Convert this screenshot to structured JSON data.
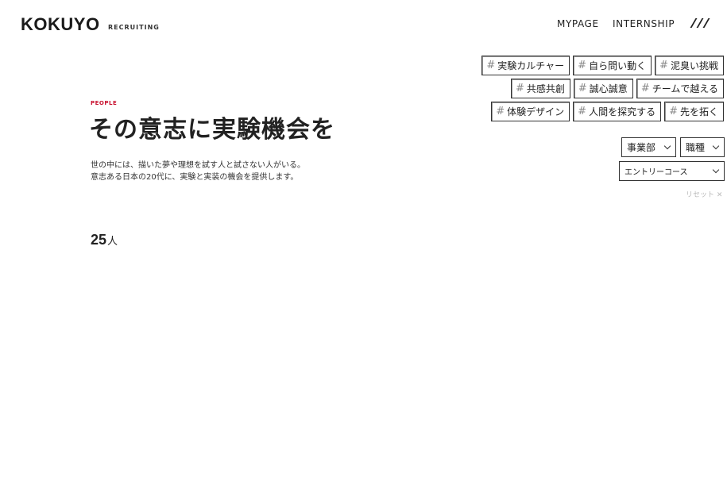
{
  "header": {
    "logo": "KOKUYO",
    "logo_sub": "RECRUITING",
    "nav": {
      "mypage": "MYPAGE",
      "internship": "INTERNSHIP"
    }
  },
  "hero": {
    "label": "PEOPLE",
    "title": "その意志に実験機会を",
    "lead_line1": "世の中には、描いた夢や理想を試す人と試さない人がいる。",
    "lead_line2": "意志ある日本の20代に、実験と実装の機会を提供します。",
    "count_value": "25",
    "count_unit": "人"
  },
  "tags": {
    "hash": "#",
    "row1": [
      "実験カルチャー",
      "自ら問い動く",
      "泥臭い挑戦"
    ],
    "row2": [
      "共感共創",
      "誠心誠意",
      "チームで越える"
    ],
    "row3": [
      "体験デザイン",
      "人間を探究する",
      "先を拓く"
    ]
  },
  "filters": {
    "department": "事業部",
    "job_type": "職種",
    "entry_course": "エントリーコース",
    "reset": "リセット ✕"
  },
  "icons": {
    "menu": "menu-slashes-icon",
    "chevron": "chevron-down-icon"
  }
}
